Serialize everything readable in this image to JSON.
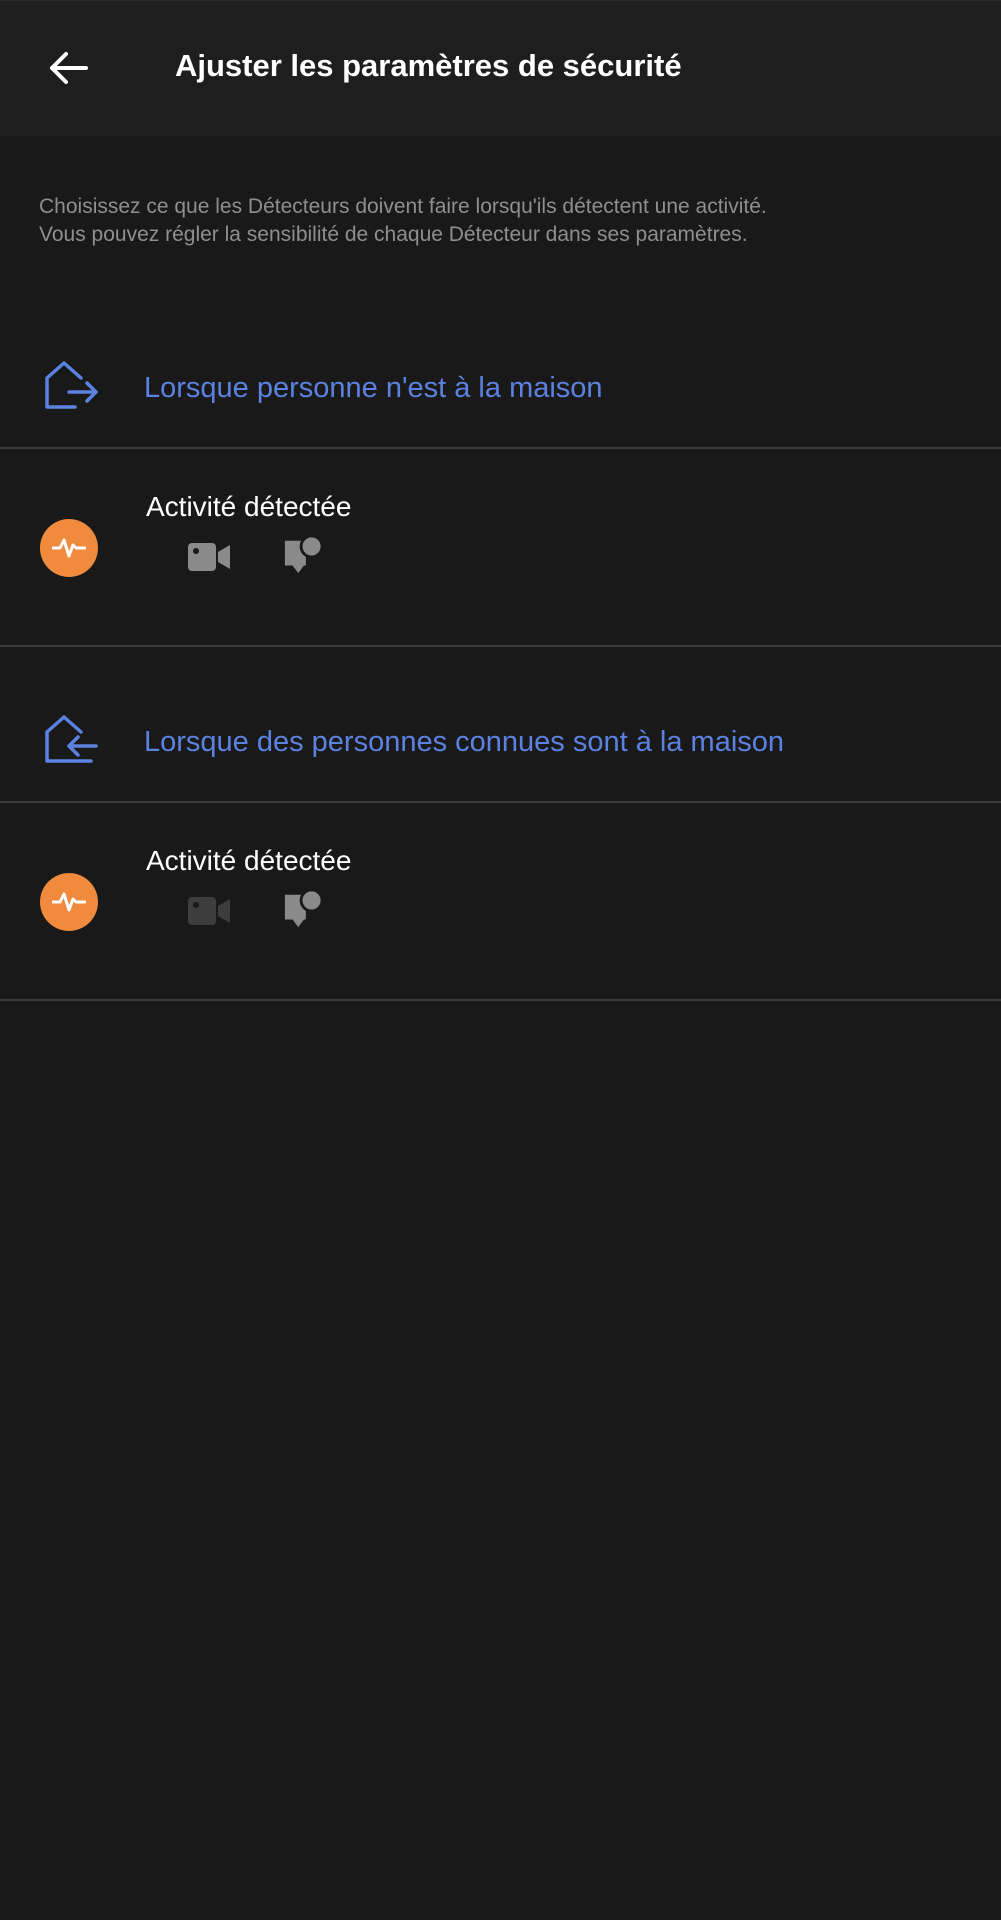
{
  "header": {
    "title": "Ajuster les paramètres de sécurité",
    "back_icon": "arrow-left-icon"
  },
  "intro": {
    "line1": "Choisissez ce que les Détecteurs doivent faire lorsqu'ils détectent une activité.",
    "line2": "Vous pouvez régler la sensibilité de chaque Détecteur dans ses paramètres."
  },
  "sections": [
    {
      "label": "Lorsque personne n'est à la maison",
      "icon": "house-exit-icon",
      "activity": {
        "title": "Activité détectée",
        "icon": "activity-pulse-icon",
        "video_icon": "video-camera-icon",
        "video_enabled": true,
        "notification_icon": "notification-bubble-icon",
        "notification_enabled": true
      }
    },
    {
      "label": "Lorsque des personnes connues sont à la maison",
      "icon": "house-enter-icon",
      "activity": {
        "title": "Activité détectée",
        "icon": "activity-pulse-icon",
        "video_icon": "video-camera-icon",
        "video_enabled": false,
        "notification_icon": "notification-bubble-icon",
        "notification_enabled": true
      }
    }
  ],
  "colors": {
    "background": "#191919",
    "accent_blue": "#5b82e0",
    "activity_orange": "#f08a3c",
    "icon_enabled": "#8a8a8a",
    "icon_disabled": "#3d3d3d"
  }
}
